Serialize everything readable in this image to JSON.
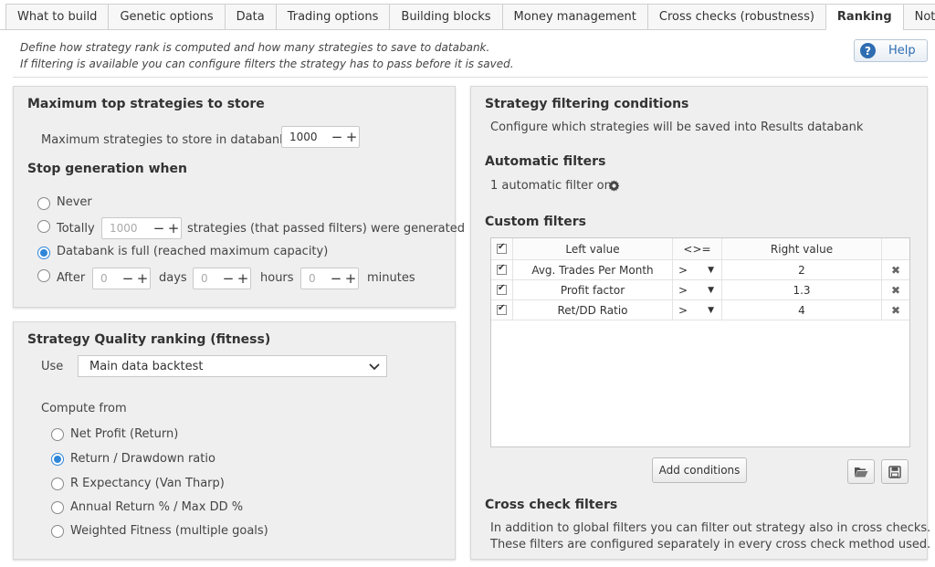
{
  "tabs": [
    "What to build",
    "Genetic options",
    "Data",
    "Trading options",
    "Building blocks",
    "Money management",
    "Cross checks (robustness)",
    "Ranking",
    "Notes"
  ],
  "active_tab": "Ranking",
  "description": {
    "line1": "Define how strategy rank is computed and how many strategies to save to databank.",
    "line2": "If filtering is available you can configure filters the strategy has to pass before it is saved."
  },
  "help_label": "Help",
  "max_top": {
    "title": "Maximum top strategies to store",
    "label": "Maximum strategies to store in databank",
    "value": "1000"
  },
  "stop": {
    "title": "Stop generation when",
    "never": "Never",
    "totally": "Totally",
    "totally_value": "1000",
    "totally_suffix": "strategies (that passed filters) were generated",
    "databank_full": "Databank is full (reached maximum capacity)",
    "after": "After",
    "days_value": "0",
    "days_label": "days",
    "hours_value": "0",
    "hours_label": "hours",
    "minutes_value": "0",
    "minutes_label": "minutes",
    "selected": "databank_full"
  },
  "quality": {
    "title": "Strategy Quality ranking (fitness)",
    "use_label": "Use",
    "use_value": "Main data backtest",
    "compute_from": "Compute from",
    "options": [
      "Net Profit (Return)",
      "Return / Drawdown ratio",
      "R Expectancy (Van Tharp)",
      "Annual Return % / Max DD %",
      "Weighted Fitness (multiple goals)"
    ],
    "selected_index": 1
  },
  "filtering": {
    "title": "Strategy filtering conditions",
    "subtitle": "Configure which strategies will be saved into Results databank",
    "auto_title": "Automatic filters",
    "auto_text": "1 automatic filter on",
    "custom_title": "Custom filters",
    "headers": {
      "left": "Left value",
      "op": "<>=",
      "right": "Right value"
    },
    "rows": [
      {
        "left": "Avg. Trades Per Month",
        "op": ">",
        "right": "2"
      },
      {
        "left": "Profit factor",
        "op": ">",
        "right": "1.3"
      },
      {
        "left": "Ret/DD Ratio",
        "op": ">",
        "right": "4"
      }
    ],
    "add_conditions": "Add conditions",
    "cross_title": "Cross check filters",
    "cross_line1": "In addition to global filters you can filter out strategy also in cross checks.",
    "cross_line2": "These filters are configured separately in every cross check method used."
  },
  "colors": {
    "accent": "#2f86d8",
    "help": "#2f6db2",
    "panel": "#efefef"
  },
  "icons": [
    "help-icon",
    "gear-icon",
    "chevron-down-icon",
    "delete-icon",
    "folder-open-icon",
    "save-icon"
  ]
}
